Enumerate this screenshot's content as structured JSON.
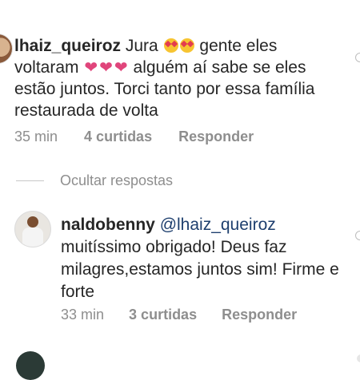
{
  "comment": {
    "username": "lhaiz_queiroz",
    "text_part1": "Jura",
    "text_part2": "gente eles voltaram",
    "text_part3": "alguém aí sabe se eles estão juntos. Torci tanto por essa família restaurada de volta",
    "time": "35 min",
    "likes": "4 curtidas",
    "reply_label": "Responder"
  },
  "hide_replies_label": "Ocultar respostas",
  "reply": {
    "username": "naldobenny",
    "mention": "@lhaiz_queiroz",
    "text": "muitíssimo obrigado! Deus faz milagres,estamos juntos sim! Firme e forte",
    "time": "33 min",
    "likes": "3 curtidas",
    "reply_label": "Responder"
  },
  "icons": {
    "smile": "smiling-face-with-heart-eyes",
    "heart": "pink-heart",
    "like": "heart-outline-icon"
  },
  "colors": {
    "text": "#262626",
    "secondary": "#8e8e8e",
    "mention": "#1e3f6e",
    "heart_emoji": "#e0457b"
  }
}
